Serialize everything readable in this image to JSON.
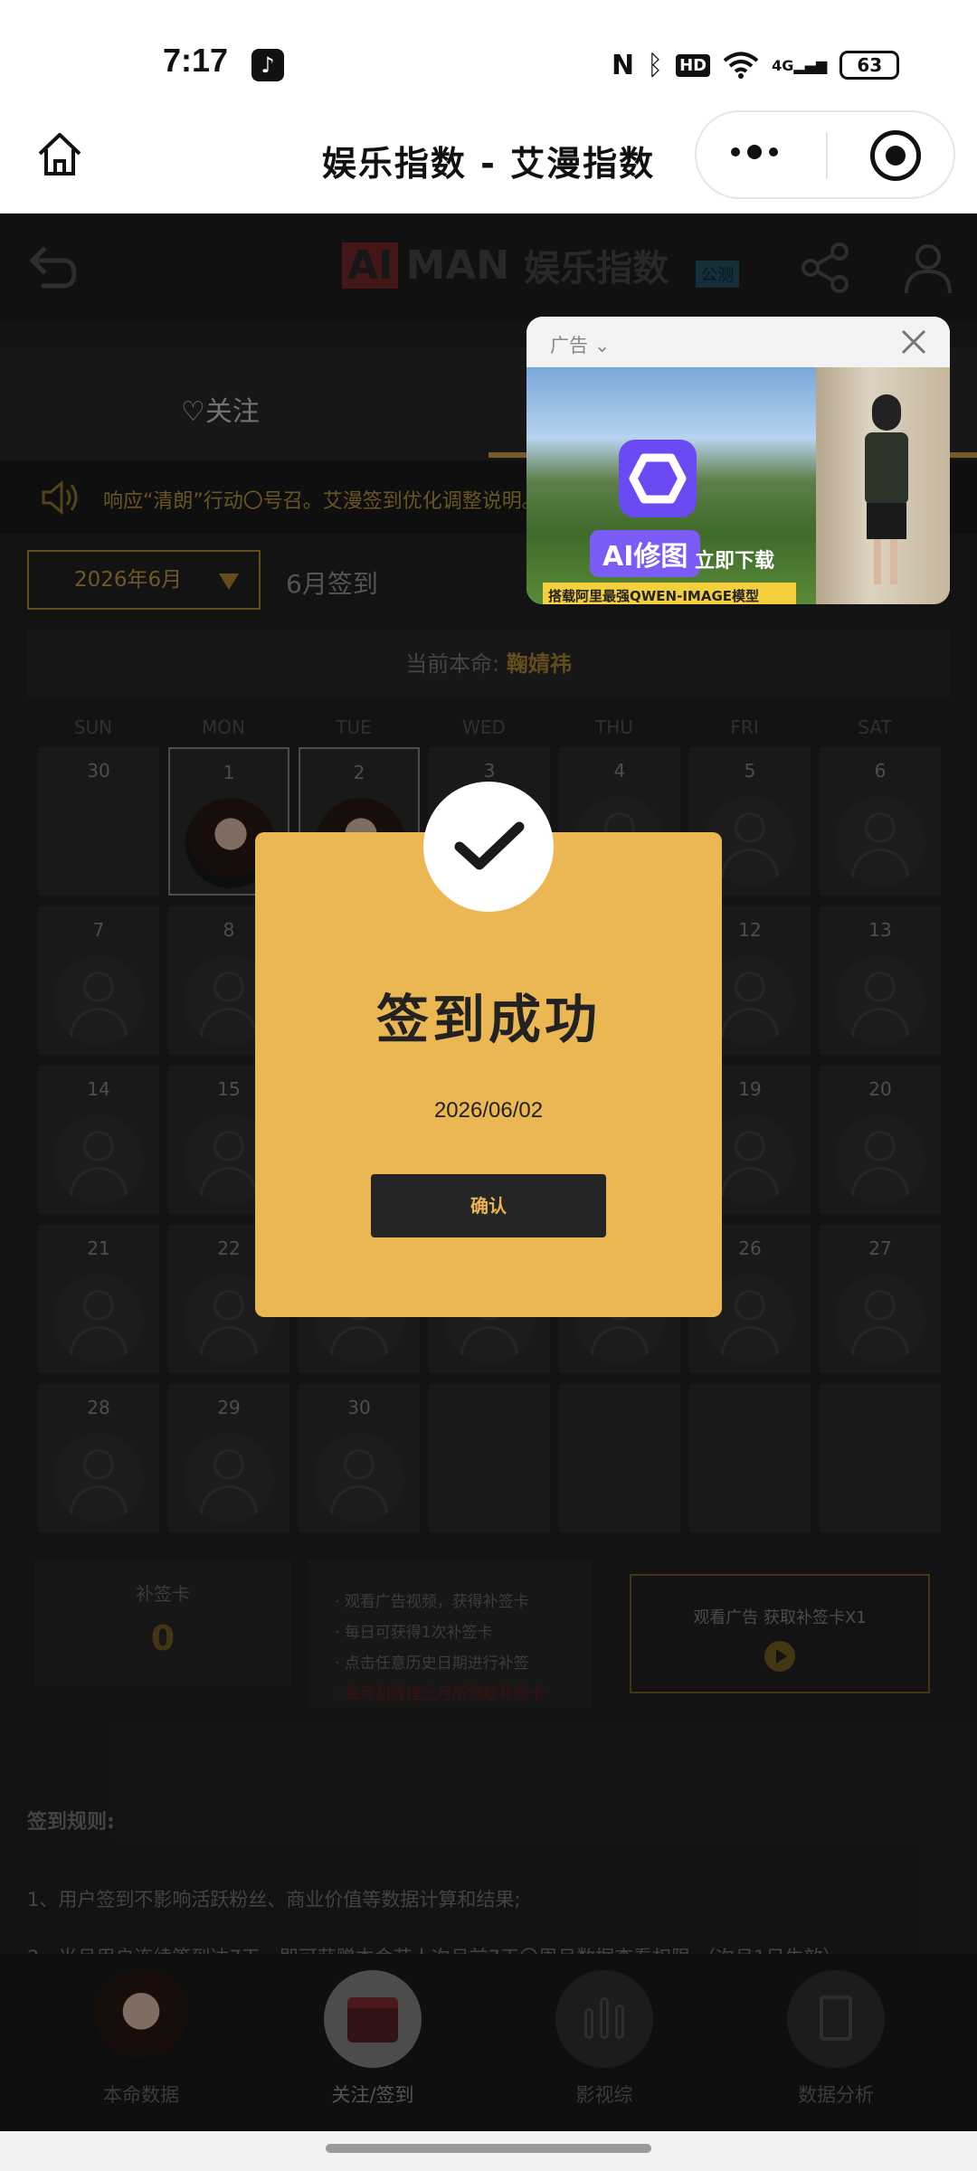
{
  "status_bar": {
    "time": "7:17",
    "battery": "63",
    "network": "4G",
    "hd": "HD"
  },
  "miniapp": {
    "title": "娱乐指数 - 艾漫指数"
  },
  "app_header": {
    "logo_ai": "AI",
    "logo_man": "MAN",
    "logo_text": "娱乐指数",
    "badge": "公测"
  },
  "tabs": {
    "follow": "关注"
  },
  "notice": {
    "text": "响应“清朗”行动〇号召。艾漫签到优化调整说明。"
  },
  "month_select": {
    "value": "2026年6月"
  },
  "month_title": "6月签到",
  "fate": {
    "label": "当前本命:",
    "name": "鞠婧祎"
  },
  "weekdays": [
    "SUN",
    "MON",
    "TUE",
    "WED",
    "THU",
    "FRI",
    "SAT"
  ],
  "calendar": [
    [
      "30",
      "1",
      "2",
      "3",
      "4",
      "5",
      "6"
    ],
    [
      "7",
      "8",
      "",
      "",
      "",
      "12",
      "13"
    ],
    [
      "14",
      "15",
      "",
      "",
      "",
      "19",
      "20"
    ],
    [
      "21",
      "22",
      "",
      "",
      "",
      "26",
      "27"
    ],
    [
      "28",
      "29",
      "30",
      "",
      "",
      "",
      ""
    ]
  ],
  "makeup_card": {
    "label": "补签卡",
    "count": "0"
  },
  "tips": [
    "· 观看广告视频，获得补签卡",
    "· 每日可获得1次补签卡",
    "· 点击任意历史日期进行补签",
    "· 每月初清理上月所领取补签卡"
  ],
  "ad_button": {
    "label": "观看广告  获取补签卡X1"
  },
  "rules": {
    "title": "签到规则:",
    "items": [
      "1、用户签到不影响活跃粉丝、商业价值等数据计算和结果;",
      "2、当月用户连续签到达7天。即可获赠本命艺人次月前7天〇周月数据查看权限:（次月1日生效）"
    ]
  },
  "bottom_nav": [
    "本命数据",
    "关注/签到",
    "影视综",
    "数据分析"
  ],
  "modal": {
    "title": "签到成功",
    "date": "2026/06/02",
    "confirm": "确认"
  },
  "ad": {
    "label": "广告",
    "ai_text": "AI修图",
    "strip": "搭载阿里最强QWEN-IMAGE模型",
    "download": "立即下载"
  },
  "colors": {
    "accent": "#EBB752",
    "dark": "#242424",
    "gold": "#B48A36"
  }
}
